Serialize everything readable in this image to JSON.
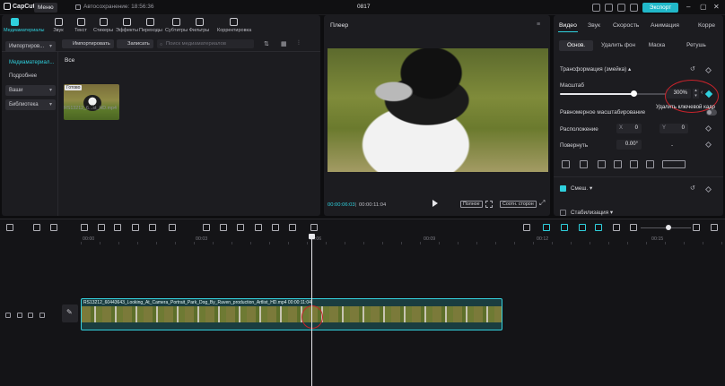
{
  "app": {
    "logo": "CapCut",
    "menu": "Меню",
    "autosave": "Автосохранение: 18:56:36",
    "project_title": "0817",
    "export": "Экспорт"
  },
  "media_toolbar": [
    "Медиаматериалы",
    "Звук",
    "Текст",
    "Стикеры",
    "Эффекты",
    "Переходы",
    "Субтитры",
    "Фильтры",
    "Корректировка"
  ],
  "media_sidebar": [
    {
      "label": "Импортиров...",
      "chevron": true
    },
    {
      "label": "Медиаматериал...",
      "chevron": false
    },
    {
      "label": "Подробнее",
      "chevron": false
    },
    {
      "label": "Ваши",
      "chevron": true
    },
    {
      "label": "Библиотека",
      "chevron": true
    }
  ],
  "media_actions": {
    "import": "Импортировать",
    "record": "Записать",
    "search_placeholder": "Поиск медиаматериалов",
    "filter_all": "Все"
  },
  "media_item": {
    "badge": "Готово",
    "filename": "RS13212_6...st_HD.mp4"
  },
  "player": {
    "title": "Плеер",
    "time_current": "00:00:06:03",
    "time_total": "00:00:11:04",
    "btn_full": "Полное",
    "btn_ratio": "Соотн. сторон"
  },
  "props": {
    "tabs": [
      "Видео",
      "Звук",
      "Скорость",
      "Анимация",
      "Корре"
    ],
    "subtabs": [
      "Основ.",
      "Удалить фон",
      "Маска",
      "Ретушь"
    ],
    "transform_title": "Трансформация (змейка)",
    "scale_label": "Масштаб",
    "scale_value": "300%",
    "scale_fraction": 0.64,
    "tooltip": "Удалить ключевой кадр",
    "uniform_scale": "Равномерное масштабирование",
    "position_label": "Расположение",
    "pos_x_label": "X",
    "pos_x": "0",
    "pos_y_label": "Y",
    "pos_y": "0",
    "rotate_label": "Повернуть",
    "rotate_value": "0.00°",
    "rotate_dash": "-",
    "blend_label": "Смеш.",
    "stabilize_label": "Стабилизация"
  },
  "timeline": {
    "ruler_labels": [
      "00:00",
      "00:03",
      "00:06",
      "00:09",
      "00:12",
      "00:15"
    ],
    "clip_name": "RS13212_60443643_Looking_At_Camera_Portrait_Park_Dog_By_Raven_production_Artlist_HD.mp4   00:00:11:04"
  },
  "colors": {
    "accent": "#21b8c9",
    "highlight_ring": "#c8232b"
  }
}
